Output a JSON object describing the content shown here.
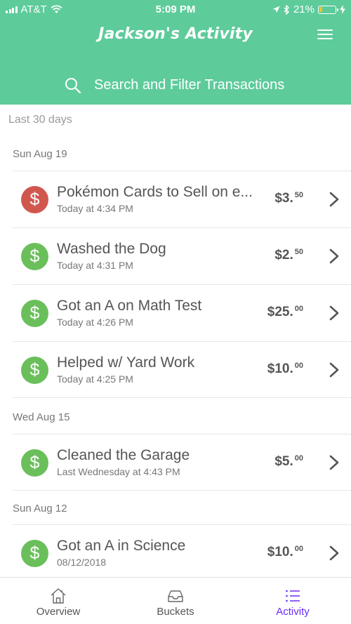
{
  "status_bar": {
    "carrier": "AT&T",
    "time": "5:09 PM",
    "battery_percent": "21%",
    "battery_level": 0.21,
    "icons": [
      "signal-icon",
      "wifi-icon",
      "location-icon",
      "bluetooth-icon",
      "battery-icon",
      "charging-icon"
    ]
  },
  "header": {
    "title": "Jackson's Activity",
    "menu_icon": "hamburger-menu-icon",
    "background_color": "#5dcb9a"
  },
  "search": {
    "label": "Search and Filter Transactions",
    "icon": "search-icon"
  },
  "list": {
    "period_label": "Last 30 days",
    "groups": [
      {
        "date": "Sun Aug 19",
        "items": [
          {
            "title": "Pokémon Cards to Sell on e...",
            "subtitle": "Today at 4:34 PM",
            "amount_main": "$3.",
            "amount_cents": "50",
            "type": "debit"
          },
          {
            "title": "Washed the Dog",
            "subtitle": "Today at 4:31 PM",
            "amount_main": "$2.",
            "amount_cents": "50",
            "type": "credit"
          },
          {
            "title": "Got an A on Math Test",
            "subtitle": "Today at 4:26 PM",
            "amount_main": "$25.",
            "amount_cents": "00",
            "type": "credit"
          },
          {
            "title": "Helped w/ Yard Work",
            "subtitle": "Today at 4:25 PM",
            "amount_main": "$10.",
            "amount_cents": "00",
            "type": "credit"
          }
        ]
      },
      {
        "date": "Wed Aug 15",
        "items": [
          {
            "title": "Cleaned the Garage",
            "subtitle": "Last Wednesday at 4:43 PM",
            "amount_main": "$5.",
            "amount_cents": "00",
            "type": "credit"
          }
        ]
      },
      {
        "date": "Sun Aug 12",
        "items": [
          {
            "title": "Got an A in Science",
            "subtitle": "08/12/2018",
            "amount_main": "$10.",
            "amount_cents": "00",
            "type": "credit"
          }
        ]
      }
    ],
    "coin_symbol": "$",
    "colors": {
      "debit": "#d1574e",
      "credit": "#6abf5b"
    }
  },
  "tabs": [
    {
      "label": "Overview",
      "icon": "house-icon",
      "active": false
    },
    {
      "label": "Buckets",
      "icon": "inbox-tray-icon",
      "active": false
    },
    {
      "label": "Activity",
      "icon": "list-icon",
      "active": true
    }
  ],
  "accent_color": "#6c2cf5"
}
